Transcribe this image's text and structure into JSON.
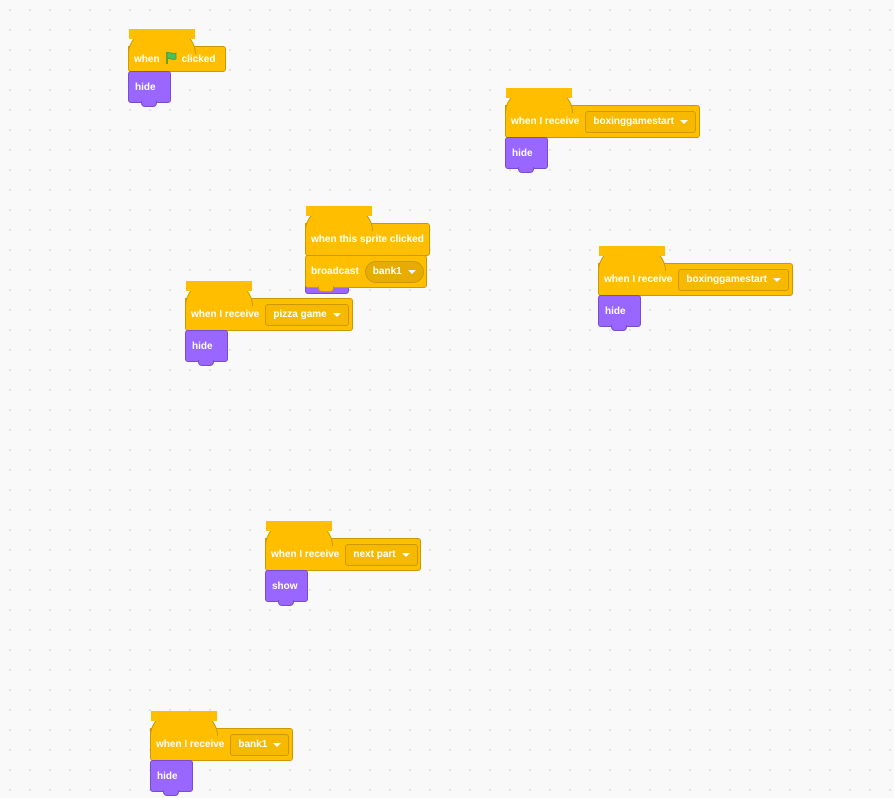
{
  "scripts": [
    {
      "hat": {
        "label_before": "when",
        "icon": "green-flag-icon",
        "label_after": "clicked"
      },
      "stack": [
        {
          "label": "hide"
        }
      ]
    },
    {
      "hat": {
        "label": "when I receive",
        "message": "boxinggamestart"
      },
      "stack": [
        {
          "label": "hide"
        }
      ]
    },
    {
      "hat": {
        "label": "when this sprite clicked"
      },
      "stack": [
        {
          "label": "broadcast",
          "message": "bank1"
        }
      ]
    },
    {
      "hat": {
        "label": "when I receive",
        "message": "boxinggamestart"
      },
      "stack": [
        {
          "label": "hide"
        }
      ]
    },
    {
      "hat": {
        "label": "when I receive",
        "message": "pizza game"
      },
      "stack": [
        {
          "label": "hide"
        }
      ]
    },
    {
      "hat": {
        "label": "when I receive",
        "message": "next part"
      },
      "stack": [
        {
          "label": "show"
        }
      ]
    },
    {
      "hat": {
        "label": "when I receive",
        "message": "bank1"
      },
      "stack": [
        {
          "label": "hide"
        }
      ]
    }
  ],
  "colors": {
    "events": "#ffbf00",
    "looks": "#9966ff",
    "workspace": "#f9f9f9",
    "flag": "#4cbf56"
  }
}
